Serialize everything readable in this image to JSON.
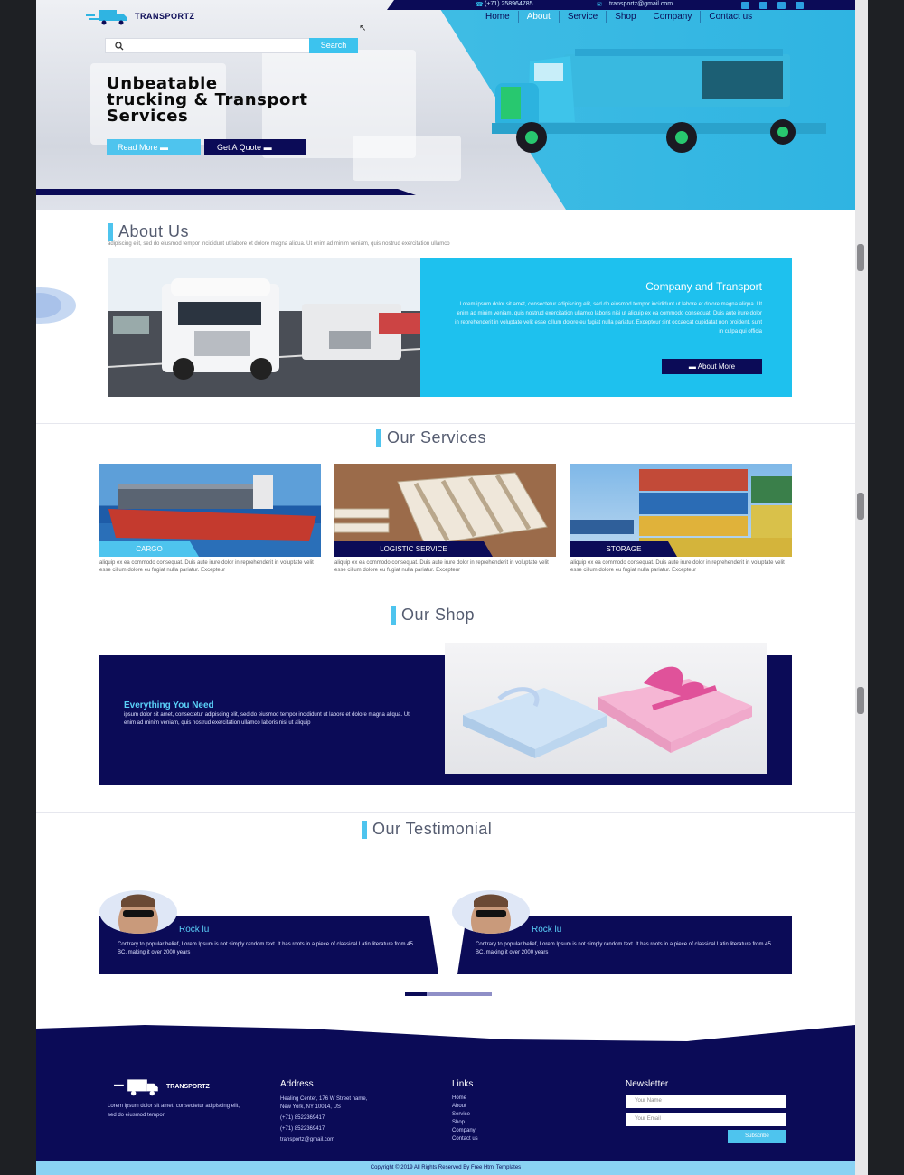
{
  "topbar": {
    "phone": "(+71) 258964785",
    "email": "transportz@gmail.com"
  },
  "brand": {
    "name": "TRANSPORTZ"
  },
  "nav": {
    "items": [
      "Home",
      "About",
      "Service",
      "Shop",
      "Company",
      "Contact us"
    ],
    "active": "About"
  },
  "search": {
    "placeholder": "",
    "button": "Search"
  },
  "hero": {
    "title_lines": [
      "Unbeatable",
      "trucking & Transport",
      "Services"
    ],
    "read_more": "Read More",
    "get_quote": "Get A Quote"
  },
  "about": {
    "heading": "About Us",
    "text": "adipiscing elit, sed do eiusmod tempor incididunt ut labore et dolore magna aliqua. Ut enim ad minim veniam, quis nostrud exercitation ullamco",
    "card_title": "Company and Transport",
    "card_body": "Lorem ipsum dolor sit amet, consectetur adipiscing elit, sed do eiusmod tempor incididunt ut labore et dolore magna aliqua. Ut enim ad minim veniam, quis nostrud exercitation ullamco laboris nisi ut aliquip ex ea commodo consequat. Duis aute irure dolor in reprehenderit in voluptate velit esse cillum dolore eu fugiat nulla pariatur. Excepteur sint occaecat cupidatat non proident, sunt in culpa qui officia",
    "card_button": "About More"
  },
  "services": {
    "heading": "Our Services",
    "items": [
      {
        "label": "CARGO",
        "text": "aliquip ex ea commodo consequat. Duis aute irure dolor in reprehenderit in voluptate velit esse cillum dolore eu fugiat nulla pariatur. Excepteur"
      },
      {
        "label": "LOGISTIC SERVICE",
        "text": "aliquip ex ea commodo consequat. Duis aute irure dolor in reprehenderit in voluptate velit esse cillum dolore eu fugiat nulla pariatur. Excepteur"
      },
      {
        "label": "STORAGE",
        "text": "aliquip ex ea commodo consequat. Duis aute irure dolor in reprehenderit in voluptate velit esse cillum dolore eu fugiat nulla pariatur. Excepteur"
      }
    ]
  },
  "shop": {
    "heading": "Our Shop",
    "title": "Everything You Need",
    "body": "ipsum dolor sit amet, consectetur adipiscing elit, sed do eiusmod tempor incididunt ut labore et dolore magna aliqua. Ut enim ad minim veniam, quis nostrud exercitation ullamco laboris nisi ut aliquip"
  },
  "testimonial": {
    "heading": "Our Testimonial",
    "items": [
      {
        "name": "Rock lu",
        "text": "Contrary to popular belief, Lorem Ipsum is not simply random text. It has roots in a piece of classical Latin literature from 45 BC, making it over 2000 years"
      },
      {
        "name": "Rock lu",
        "text": "Contrary to popular belief, Lorem Ipsum is not simply random text. It has roots in a piece of classical Latin literature from 45 BC, making it over 2000 years"
      }
    ]
  },
  "footer": {
    "brand": "TRANSPORTZ",
    "about": "Lorem ipsum dolor sit amet, consectetur adipiscing elit, sed do eiusmod tempor",
    "address_heading": "Address",
    "address_lines": [
      "Healing Center, 176 W Street name,",
      "New York, NY 10014, US",
      "(+71) 8522369417",
      "(+71) 8522369417",
      "transportz@gmail.com"
    ],
    "links_heading": "Links",
    "links": [
      "Home",
      "About",
      "Service",
      "Shop",
      "Company",
      "Contact us"
    ],
    "newsletter_heading": "Newsletter",
    "name_placeholder": "Your Name",
    "email_placeholder": "Your Email",
    "subscribe": "Subscribe",
    "copyright": "Copyright © 2019 All Rights Reserved By Free Html Templates"
  },
  "colors": {
    "navy": "#0b0b57",
    "cyan": "#1ec1ee",
    "light_cyan": "#4ec4ee"
  },
  "icons": [
    "search-icon",
    "phone-icon",
    "mail-icon",
    "truck-logo-icon",
    "facebook-icon",
    "google-icon",
    "linkedin-icon",
    "twitter-icon",
    "arrow-icon"
  ]
}
